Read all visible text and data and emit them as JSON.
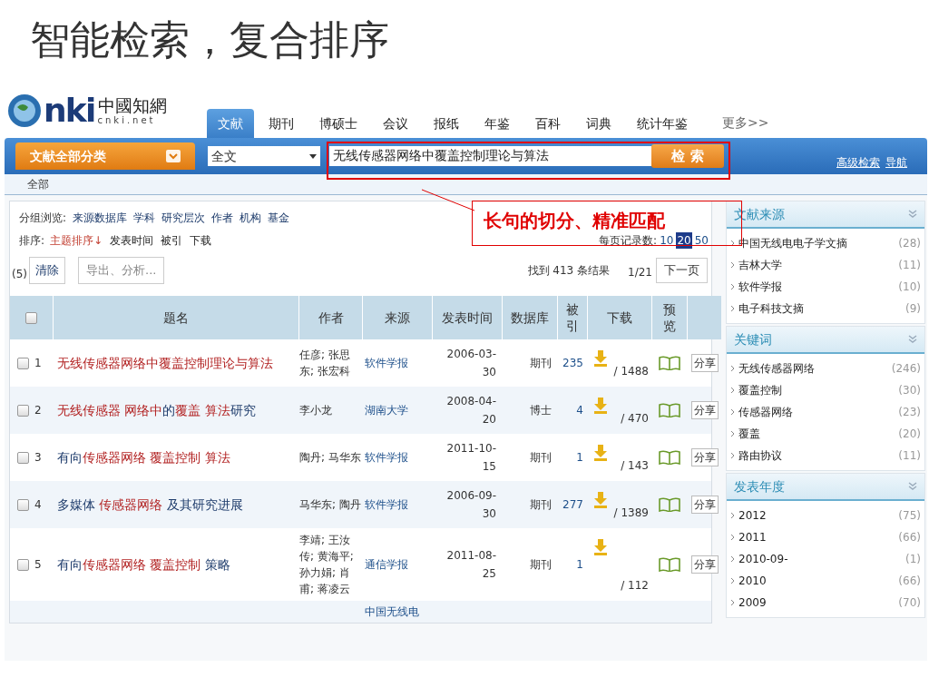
{
  "slide_title": "智能检索，复合排序",
  "site": {
    "logo_mark": "nki",
    "logo_name": "中國知網",
    "logo_domain": "cnki.net",
    "nav_tabs": [
      {
        "label": "文献",
        "selected": true
      },
      {
        "label": "期刊",
        "selected": false
      },
      {
        "label": "博硕士",
        "selected": false
      },
      {
        "label": "会议",
        "selected": false
      },
      {
        "label": "报纸",
        "selected": false
      },
      {
        "label": "年鉴",
        "selected": false
      },
      {
        "label": "百科",
        "selected": false
      },
      {
        "label": "词典",
        "selected": false
      },
      {
        "label": "统计年鉴",
        "selected": false
      }
    ],
    "more_link": "更多>>",
    "category_button": "文献全部分类",
    "field_select": "全文",
    "search_value": "无线传感器网络中覆盖控制理论与算法",
    "search_button": "检 索",
    "header_links": [
      "高级检索",
      "导航"
    ],
    "scope": "全部"
  },
  "group_browse": {
    "label": "分组浏览:",
    "items": [
      "来源数据库",
      "学科",
      "研究层次",
      "作者",
      "机构",
      "基金"
    ]
  },
  "sort": {
    "label": "排序:",
    "items": [
      {
        "label": "主题排序↓",
        "selected": true
      },
      {
        "label": "发表时间",
        "selected": false
      },
      {
        "label": "被引",
        "selected": false
      },
      {
        "label": "下载",
        "selected": false
      }
    ]
  },
  "per_page": {
    "label": "每页记录数:",
    "options": [
      {
        "label": "10",
        "selected": false
      },
      {
        "label": "20",
        "selected": true
      },
      {
        "label": "50",
        "selected": false
      }
    ]
  },
  "toolbar": {
    "selected_count": "(5)",
    "clear_button": "清除",
    "export_button": "导出、分析...",
    "result_count": "找到 413 条结果",
    "page": "1/21",
    "next_button": "下一页"
  },
  "table": {
    "header_checked": false,
    "columns": [
      "题名",
      "作者",
      "来源",
      "发表时间",
      "数据库",
      "被引",
      "下载",
      "预览"
    ],
    "rows": [
      {
        "checked": false,
        "index": "1",
        "title": [
          {
            "text": "无线传感器网络中覆盖控制理论与算法",
            "highlight": true
          }
        ],
        "author": "任彦; 张思东; 张宏科",
        "source": "软件学报",
        "date": "2006-03-30",
        "database": "期刊",
        "cited": "235",
        "downloads": "/ 1488",
        "share": "分享"
      },
      {
        "checked": false,
        "index": "2",
        "title": [
          {
            "text": "无线传感器 网络中",
            "highlight": true
          },
          {
            "text": "的",
            "highlight": false
          },
          {
            "text": "覆盖 算法",
            "highlight": true
          },
          {
            "text": "研究",
            "highlight": false
          }
        ],
        "author": "李小龙",
        "source": "湖南大学",
        "date": "2008-04-20",
        "database": "博士",
        "cited": "4",
        "downloads": "/ 470",
        "share": "分享"
      },
      {
        "checked": false,
        "index": "3",
        "title": [
          {
            "text": "有向",
            "highlight": false
          },
          {
            "text": "传感器网络 覆盖控制 算法",
            "highlight": true
          }
        ],
        "author": "陶丹; 马华东",
        "source": "软件学报",
        "date": "2011-10-15",
        "database": "期刊",
        "cited": "1",
        "downloads": "/ 143",
        "share": "分享"
      },
      {
        "checked": false,
        "index": "4",
        "title": [
          {
            "text": "多媒体 ",
            "highlight": false
          },
          {
            "text": "传感器网络",
            "highlight": true
          },
          {
            "text": " 及其研究进展",
            "highlight": false
          }
        ],
        "author": "马华东; 陶丹",
        "source": "软件学报",
        "date": "2006-09-30",
        "database": "期刊",
        "cited": "277",
        "downloads": "/ 1389",
        "share": "分享"
      },
      {
        "checked": false,
        "index": "5",
        "title": [
          {
            "text": "有向",
            "highlight": false
          },
          {
            "text": "传感器网络 覆盖控制",
            "highlight": true
          },
          {
            "text": " 策略",
            "highlight": false
          }
        ],
        "author": "李靖; 王汝传; 黄海平; 孙力娟; 肖甫; 蒋凌云",
        "source": "通信学报",
        "date": "2011-08-25",
        "database": "期刊",
        "cited": "1",
        "downloads": "/ 112",
        "share": "分享"
      },
      {
        "source": "中国无线电"
      }
    ]
  },
  "sidebar": [
    {
      "title": "文献来源",
      "items": [
        {
          "label": "中国无线电电子学文摘",
          "count": "(28)"
        },
        {
          "label": "吉林大学",
          "count": "(11)"
        },
        {
          "label": "软件学报",
          "count": "(10)"
        },
        {
          "label": "电子科技文摘",
          "count": "(9)"
        }
      ]
    },
    {
      "title": "关键词",
      "items": [
        {
          "label": "无线传感器网络",
          "count": "(246)"
        },
        {
          "label": "覆盖控制",
          "count": "(30)"
        },
        {
          "label": "传感器网络",
          "count": "(23)"
        },
        {
          "label": "覆盖",
          "count": "(20)"
        },
        {
          "label": "路由协议",
          "count": "(11)"
        }
      ]
    },
    {
      "title": "发表年度",
      "items": [
        {
          "label": "2012",
          "count": "(75)"
        },
        {
          "label": "2011",
          "count": "(66)"
        },
        {
          "label": "2010-09-",
          "count": "(1)"
        },
        {
          "label": "2010",
          "count": "(66)"
        },
        {
          "label": "2009",
          "count": "(70)"
        }
      ]
    }
  ],
  "annotation": {
    "callout": "长句的切分、精准匹配"
  }
}
